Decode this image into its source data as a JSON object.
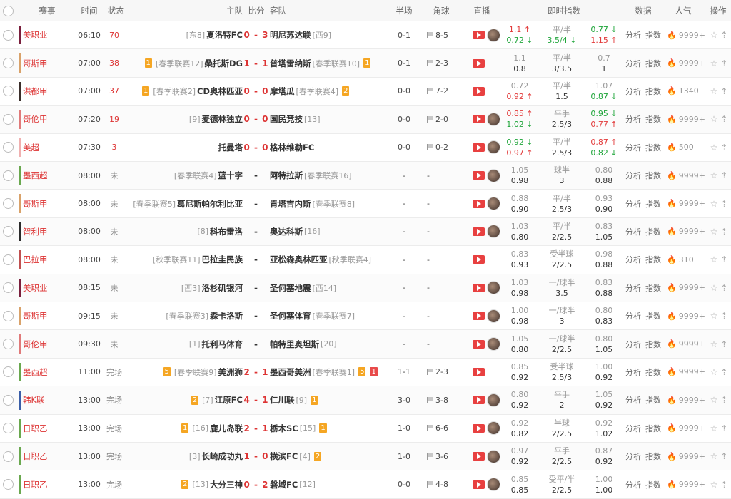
{
  "header": {
    "league": "赛事",
    "time": "时间",
    "status": "状态",
    "home": "主队",
    "score": "比分",
    "away": "客队",
    "half": "半场",
    "corner": "角球",
    "live": "直播",
    "odds": "即时指数",
    "data": "数据",
    "popularity": "人气",
    "action": "操作"
  },
  "labels": {
    "analysis": "分析",
    "index": "指数"
  },
  "colors": {
    "red": "#e23a3a",
    "green": "#1fa53a",
    "live": "#e84040"
  },
  "matches": [
    {
      "league": "美职业",
      "lc": "#7a1f3d",
      "time": "06:10",
      "status": "70",
      "home": "夏洛特FC",
      "hrank": "[东8]",
      "hy": "",
      "away": "明尼苏达联",
      "arank": "[西9]",
      "ay": "",
      "score": "0 - 3",
      "half": "0-1",
      "corner": "8-5",
      "avatar": true,
      "o1a": "1.1",
      "o1ac": "red",
      "o1b": "0.72",
      "o1bc": "green",
      "o2a": "平/半",
      "o2b": "3.5/4",
      "o2bc": "green",
      "o3a": "0.77",
      "o3ac": "green",
      "o3b": "1.15",
      "o3bc": "red",
      "pop": "9999+",
      "hot": true
    },
    {
      "league": "哥斯甲",
      "lc": "#d9a26a",
      "time": "07:00",
      "status": "38",
      "home": "桑托斯DG",
      "hrank": "[春季联赛12]",
      "hy": "1",
      "away": "普塔雷纳斯",
      "arank": "[春季联赛10]",
      "ay": "1",
      "score": "1 - 1",
      "half": "0-1",
      "corner": "2-3",
      "avatar": false,
      "o1a": "1.1",
      "o1ac": "dim",
      "o1b": "0.8",
      "o1bc": "dk",
      "o2a": "平/半",
      "o2b": "3/3.5",
      "o2bc": "dk",
      "o3a": "0.7",
      "o3ac": "dim",
      "o3b": "1",
      "o3bc": "dk",
      "pop": "9999+",
      "hot": true
    },
    {
      "league": "洪都甲",
      "lc": "#3a2e2a",
      "time": "07:00",
      "status": "37",
      "home": "CD奥林匹亚",
      "hrank": "[春季联赛2]",
      "hy": "1",
      "away": "摩塔瓜",
      "arank": "[春季联赛4]",
      "ay": "2",
      "score": "0 - 0",
      "half": "0-0",
      "corner": "7-2",
      "avatar": false,
      "o1a": "0.72",
      "o1ac": "dim",
      "o1b": "0.92",
      "o1bc": "red",
      "o2a": "平/半",
      "o2b": "1.5",
      "o2bc": "dk",
      "o3a": "1.07",
      "o3ac": "dim",
      "o3b": "0.87",
      "o3bc": "green",
      "pop": "1340",
      "hot": false
    },
    {
      "league": "哥伦甲",
      "lc": "#e07a7a",
      "time": "07:20",
      "status": "19",
      "home": "麦德林独立",
      "hrank": "[9]",
      "hy": "",
      "away": "国民竞技",
      "arank": "[13]",
      "ay": "",
      "score": "0 - 0",
      "half": "0-0",
      "corner": "2-0",
      "avatar": true,
      "o1a": "0.85",
      "o1ac": "red",
      "o1b": "1.02",
      "o1bc": "green",
      "o2a": "平手",
      "o2b": "2.5/3",
      "o2bc": "dk",
      "o3a": "0.95",
      "o3ac": "green",
      "o3b": "0.77",
      "o3bc": "red",
      "pop": "9999+",
      "hot": true
    },
    {
      "league": "美超",
      "lc": "#f0b0b0",
      "time": "07:30",
      "status": "3",
      "home": "托曼塔",
      "hrank": "",
      "hy": "",
      "away": "格林维勒FC",
      "arank": "",
      "ay": "",
      "score": "0 - 0",
      "half": "0-0",
      "corner": "0-2",
      "avatar": true,
      "o1a": "0.92",
      "o1ac": "green",
      "o1b": "0.97",
      "o1bc": "red",
      "o2a": "平/半",
      "o2b": "2.5/3",
      "o2bc": "dk",
      "o3a": "0.87",
      "o3ac": "red",
      "o3b": "0.82",
      "o3bc": "green",
      "pop": "500",
      "hot": false
    },
    {
      "league": "墨西超",
      "lc": "#6aa84f",
      "time": "08:00",
      "status": "未",
      "home": "蓝十字",
      "hrank": "[春季联赛4]",
      "hy": "",
      "away": "阿特拉斯",
      "arank": "[春季联赛16]",
      "ay": "",
      "score": "-",
      "half": "-",
      "corner": "-",
      "avatar": true,
      "o1a": "1.05",
      "o1ac": "dim",
      "o1b": "0.98",
      "o1bc": "dk",
      "o2a": "球半",
      "o2b": "3",
      "o2bc": "dk",
      "o3a": "0.80",
      "o3ac": "dim",
      "o3b": "0.88",
      "o3bc": "dk",
      "pop": "9999+",
      "hot": true
    },
    {
      "league": "哥斯甲",
      "lc": "#d9a26a",
      "time": "08:00",
      "status": "未",
      "home": "葛尼斯帕尔利比亚",
      "hrank": "[春季联赛5]",
      "hy": "",
      "away": "肯塔吉内斯",
      "arank": "[春季联赛8]",
      "ay": "",
      "score": "-",
      "half": "-",
      "corner": "-",
      "avatar": true,
      "o1a": "0.88",
      "o1ac": "dim",
      "o1b": "0.90",
      "o1bc": "dk",
      "o2a": "平/半",
      "o2b": "2.5/3",
      "o2bc": "dk",
      "o3a": "0.93",
      "o3ac": "dim",
      "o3b": "0.90",
      "o3bc": "dk",
      "pop": "9999+",
      "hot": true
    },
    {
      "league": "智利甲",
      "lc": "#2a2a2a",
      "time": "08:00",
      "status": "未",
      "home": "科布雷洛",
      "hrank": "[8]",
      "hy": "",
      "away": "奥达科斯",
      "arank": "[16]",
      "ay": "",
      "score": "-",
      "half": "-",
      "corner": "-",
      "avatar": true,
      "o1a": "1.03",
      "o1ac": "dim",
      "o1b": "0.80",
      "o1bc": "dk",
      "o2a": "平/半",
      "o2b": "2/2.5",
      "o2bc": "dk",
      "o3a": "0.83",
      "o3ac": "dim",
      "o3b": "1.05",
      "o3bc": "dk",
      "pop": "9999+",
      "hot": true
    },
    {
      "league": "巴拉甲",
      "lc": "#c05050",
      "time": "08:00",
      "status": "未",
      "home": "巴拉圭民族",
      "hrank": "[秋季联赛11]",
      "hy": "",
      "away": "亚松森奥林匹亚",
      "arank": "[秋季联赛4]",
      "ay": "",
      "score": "-",
      "half": "-",
      "corner": "-",
      "avatar": false,
      "o1a": "0.83",
      "o1ac": "dim",
      "o1b": "0.93",
      "o1bc": "dk",
      "o2a": "受半球",
      "o2b": "2/2.5",
      "o2bc": "dk",
      "o3a": "0.98",
      "o3ac": "dim",
      "o3b": "0.88",
      "o3bc": "dk",
      "pop": "310",
      "hot": true
    },
    {
      "league": "美职业",
      "lc": "#7a1f3d",
      "time": "08:15",
      "status": "未",
      "home": "洛杉矶银河",
      "hrank": "[西3]",
      "hy": "",
      "away": "圣何塞地震",
      "arank": "[西14]",
      "ay": "",
      "score": "-",
      "half": "-",
      "corner": "-",
      "avatar": true,
      "o1a": "1.03",
      "o1ac": "dim",
      "o1b": "0.98",
      "o1bc": "dk",
      "o2a": "一/球半",
      "o2b": "3.5",
      "o2bc": "dk",
      "o3a": "0.83",
      "o3ac": "dim",
      "o3b": "0.88",
      "o3bc": "dk",
      "pop": "9999+",
      "hot": true
    },
    {
      "league": "哥斯甲",
      "lc": "#d9a26a",
      "time": "09:15",
      "status": "未",
      "home": "森卡洛斯",
      "hrank": "[春季联赛3]",
      "hy": "",
      "away": "圣何塞体育",
      "arank": "[春季联赛7]",
      "ay": "",
      "score": "-",
      "half": "-",
      "corner": "-",
      "avatar": true,
      "o1a": "1.00",
      "o1ac": "dim",
      "o1b": "0.98",
      "o1bc": "dk",
      "o2a": "一/球半",
      "o2b": "3",
      "o2bc": "dk",
      "o3a": "0.80",
      "o3ac": "dim",
      "o3b": "0.83",
      "o3bc": "dk",
      "pop": "9999+",
      "hot": true
    },
    {
      "league": "哥伦甲",
      "lc": "#e07a7a",
      "time": "09:30",
      "status": "未",
      "home": "托利马体育",
      "hrank": "[1]",
      "hy": "",
      "away": "帕特里奥坦斯",
      "arank": "[20]",
      "ay": "",
      "score": "-",
      "half": "-",
      "corner": "-",
      "avatar": true,
      "o1a": "1.05",
      "o1ac": "dim",
      "o1b": "0.80",
      "o1bc": "dk",
      "o2a": "一/球半",
      "o2b": "2/2.5",
      "o2bc": "dk",
      "o3a": "0.80",
      "o3ac": "dim",
      "o3b": "1.05",
      "o3bc": "dk",
      "pop": "9999+",
      "hot": true
    },
    {
      "league": "墨西超",
      "lc": "#6aa84f",
      "time": "11:00",
      "status": "完场",
      "home": "美洲狮",
      "hrank": "[春季联赛9]",
      "hy": "5",
      "away": "墨西哥美洲",
      "arank": "[春季联赛1]",
      "ay": "5",
      "ar": "1",
      "score": "2 - 1",
      "half": "1-1",
      "corner": "2-3",
      "avatar": false,
      "o1a": "0.85",
      "o1ac": "dim",
      "o1b": "0.92",
      "o1bc": "dk",
      "o2a": "受半球",
      "o2b": "2.5/3",
      "o2bc": "dk",
      "o3a": "1.00",
      "o3ac": "dim",
      "o3b": "0.92",
      "o3bc": "dk",
      "pop": "9999+",
      "hot": true
    },
    {
      "league": "韩K联",
      "lc": "#3a5ea8",
      "time": "13:00",
      "status": "完场",
      "home": "江原FC",
      "hrank": "[7]",
      "hy": "2",
      "away": "仁川联",
      "arank": "[9]",
      "ay": "1",
      "score": "4 - 1",
      "half": "3-0",
      "corner": "3-8",
      "avatar": true,
      "o1a": "0.80",
      "o1ac": "dim",
      "o1b": "0.92",
      "o1bc": "dk",
      "o2a": "平手",
      "o2b": "2",
      "o2bc": "dk",
      "o3a": "1.05",
      "o3ac": "dim",
      "o3b": "0.92",
      "o3bc": "dk",
      "pop": "9999+",
      "hot": true
    },
    {
      "league": "日职乙",
      "lc": "#6aa84f",
      "time": "13:00",
      "status": "完场",
      "home": "鹿儿岛联",
      "hrank": "[16]",
      "hy": "1",
      "away": "栃木SC",
      "arank": "[15]",
      "ay": "1",
      "score": "2 - 1",
      "half": "1-0",
      "corner": "6-6",
      "avatar": true,
      "o1a": "0.92",
      "o1ac": "dim",
      "o1b": "0.82",
      "o1bc": "dk",
      "o2a": "半球",
      "o2b": "2/2.5",
      "o2bc": "dk",
      "o3a": "0.92",
      "o3ac": "dim",
      "o3b": "1.02",
      "o3bc": "dk",
      "pop": "9999+",
      "hot": true
    },
    {
      "league": "日职乙",
      "lc": "#6aa84f",
      "time": "13:00",
      "status": "完场",
      "home": "长崎成功丸",
      "hrank": "[3]",
      "hy": "",
      "away": "横滨FC",
      "arank": "[4]",
      "ay": "2",
      "score": "1 - 0",
      "half": "1-0",
      "corner": "3-6",
      "avatar": true,
      "o1a": "0.97",
      "o1ac": "dim",
      "o1b": "0.92",
      "o1bc": "dk",
      "o2a": "平手",
      "o2b": "2/2.5",
      "o2bc": "dk",
      "o3a": "0.87",
      "o3ac": "dim",
      "o3b": "0.92",
      "o3bc": "dk",
      "pop": "9999+",
      "hot": true
    },
    {
      "league": "日职乙",
      "lc": "#6aa84f",
      "time": "13:00",
      "status": "完场",
      "home": "大分三神",
      "hrank": "[13]",
      "hy": "2",
      "away": "磐城FC",
      "arank": "[12]",
      "ay": "",
      "score": "0 - 2",
      "half": "0-0",
      "corner": "4-8",
      "avatar": true,
      "o1a": "0.85",
      "o1ac": "dim",
      "o1b": "0.85",
      "o1bc": "dk",
      "o2a": "受平/半",
      "o2b": "2/2.5",
      "o2bc": "dk",
      "o3a": "1.00",
      "o3ac": "dim",
      "o3b": "1.00",
      "o3bc": "dk",
      "pop": "9999+",
      "hot": true
    }
  ]
}
